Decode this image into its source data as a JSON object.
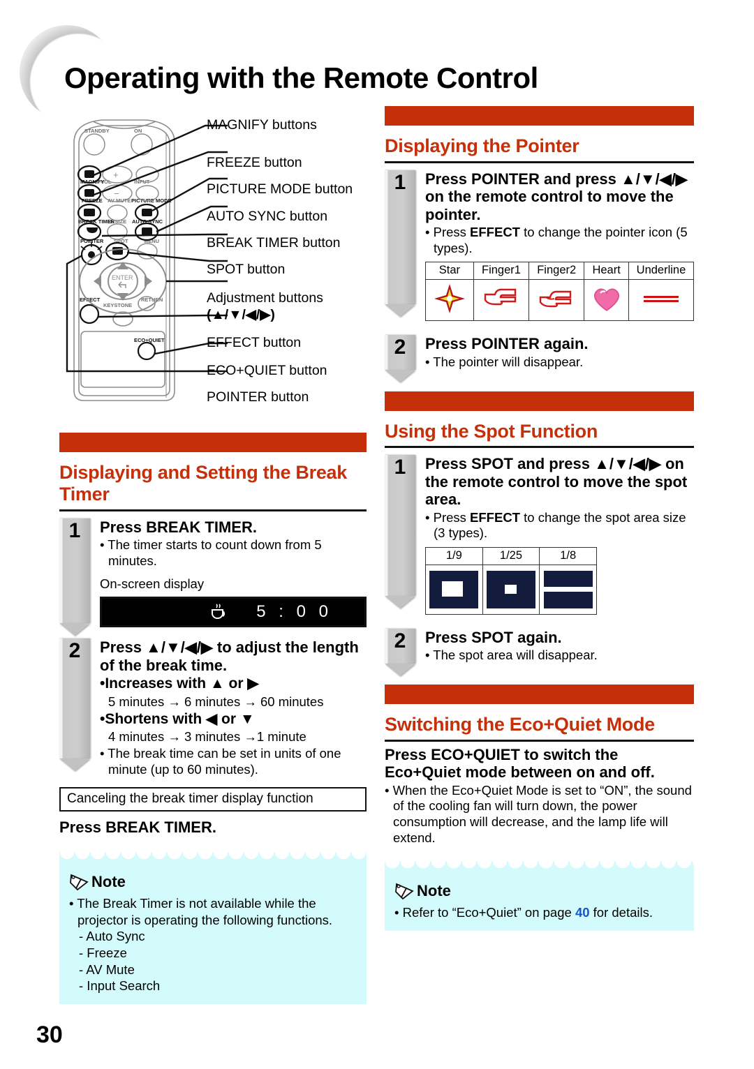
{
  "page": {
    "title": "Operating with the Remote Control",
    "number": "30"
  },
  "remote_figure": {
    "callouts": [
      {
        "label": "MAGNIFY buttons"
      },
      {
        "label": "FREEZE button"
      },
      {
        "label": "PICTURE MODE button"
      },
      {
        "label": "AUTO SYNC button"
      },
      {
        "label": "BREAK TIMER button"
      },
      {
        "label": "SPOT button"
      },
      {
        "label": "Adjustment buttons"
      },
      {
        "label": "(▲/▼/◀/▶)"
      },
      {
        "label": "EFFECT button"
      },
      {
        "label": "ECO+QUIET button"
      },
      {
        "label": "POINTER button"
      }
    ],
    "remote_labels": {
      "standby": "STANDBY",
      "on": "ON",
      "magnify": "MAGNIFY",
      "vol": "VOL",
      "input": "INPUT",
      "freeze": "FREEZE",
      "av_mute": "AV MUTE",
      "picture_mode": "PICTURE MODE",
      "break_timer": "BREAK TIMER",
      "resize": "RESIZE",
      "auto_sync": "AUTO SYNC",
      "pointer": "POINTER",
      "spot": "SPOT",
      "menu": "MENU",
      "enter": "ENTER",
      "effect": "EFFECT",
      "keystone": "KEYSTONE",
      "return": "RETURN",
      "eco_quiet": "ECO+QUIET"
    }
  },
  "break_timer_section": {
    "title": "Displaying and Setting the Break Timer",
    "steps": [
      {
        "number": "1",
        "head_pre": "Press ",
        "head_kw": "BREAK TIMER",
        "head_post": ".",
        "bullets": [
          "• The timer starts to count down from 5 minutes."
        ],
        "osd_label": "On-screen display",
        "osd_time": "5 : 0 0"
      },
      {
        "number": "2",
        "head": "Press ▲/▼/◀/▶ to adjust the length of the break time.",
        "sub_bold_1": "•Increases with ▲ or ▶",
        "sub_text_1": "5 minutes → 6 minutes → 60 minutes",
        "sub_bold_2": "•Shortens with ◀ or ▼",
        "sub_text_2": "4 minutes → 3 minutes →1 minute",
        "bullet_last": "• The break time can be set in units of one minute (up to 60 minutes)."
      }
    ],
    "cancel_box": "Canceling the break timer display function",
    "cancel_press_pre": "Press ",
    "cancel_press_kw": "BREAK TIMER",
    "cancel_press_post": ".",
    "note": {
      "label": "Note",
      "items": [
        "• The Break Timer is not available while the projector is operating the following functions."
      ],
      "sub_items": [
        "- Auto Sync",
        "- Freeze",
        "- AV Mute",
        "- Input Search"
      ]
    }
  },
  "pointer_section": {
    "title": "Displaying the Pointer",
    "steps": [
      {
        "number": "1",
        "head": "Press POINTER and press ▲/▼/◀/▶ on the remote control to move the pointer.",
        "head_kw": "POINTER",
        "bullet_pre": "• Press ",
        "bullet_kw": "EFFECT",
        "bullet_post": " to change the pointer icon (5 types)."
      },
      {
        "number": "2",
        "head_pre": "Press ",
        "head_kw": "POINTER",
        "head_post": " again.",
        "bullet": "• The pointer will disappear."
      }
    ],
    "icon_table": {
      "headers": [
        "Star",
        "Finger1",
        "Finger2",
        "Heart",
        "Underline"
      ]
    }
  },
  "spot_section": {
    "title": "Using the Spot Function",
    "steps": [
      {
        "number": "1",
        "head": "Press SPOT and press ▲/▼/◀/▶ on the remote control to move the spot area.",
        "head_kw": "SPOT",
        "bullet_pre": "• Press ",
        "bullet_kw": "EFFECT",
        "bullet_post": " to change the spot area size (3 types)."
      },
      {
        "number": "2",
        "head_pre": "Press ",
        "head_kw": "SPOT",
        "head_post": " again.",
        "bullet": "• The spot area will disappear."
      }
    ],
    "size_table": {
      "headers": [
        "1/9",
        "1/25",
        "1/8"
      ]
    }
  },
  "eco_section": {
    "title": "Switching the Eco+Quiet Mode",
    "head_pre": "Press ",
    "head_kw": "ECO+QUIET",
    "head_post": " to switch the Eco+Quiet mode between on and off.",
    "bullet": "• When the Eco+Quiet Mode is set to “ON”, the sound of the cooling fan will turn down, the power consumption will decrease, and the lamp life will extend.",
    "note": {
      "label": "Note",
      "item_pre": "• Refer to “Eco+Quiet” on page ",
      "item_page": "40",
      "item_post": " for details."
    }
  },
  "colors": {
    "accent": "#c5300a",
    "note_bg": "#d4fbfb",
    "page_link": "#1556c8",
    "osd_bg": "#000000",
    "spot_navy": "#141c3e"
  }
}
